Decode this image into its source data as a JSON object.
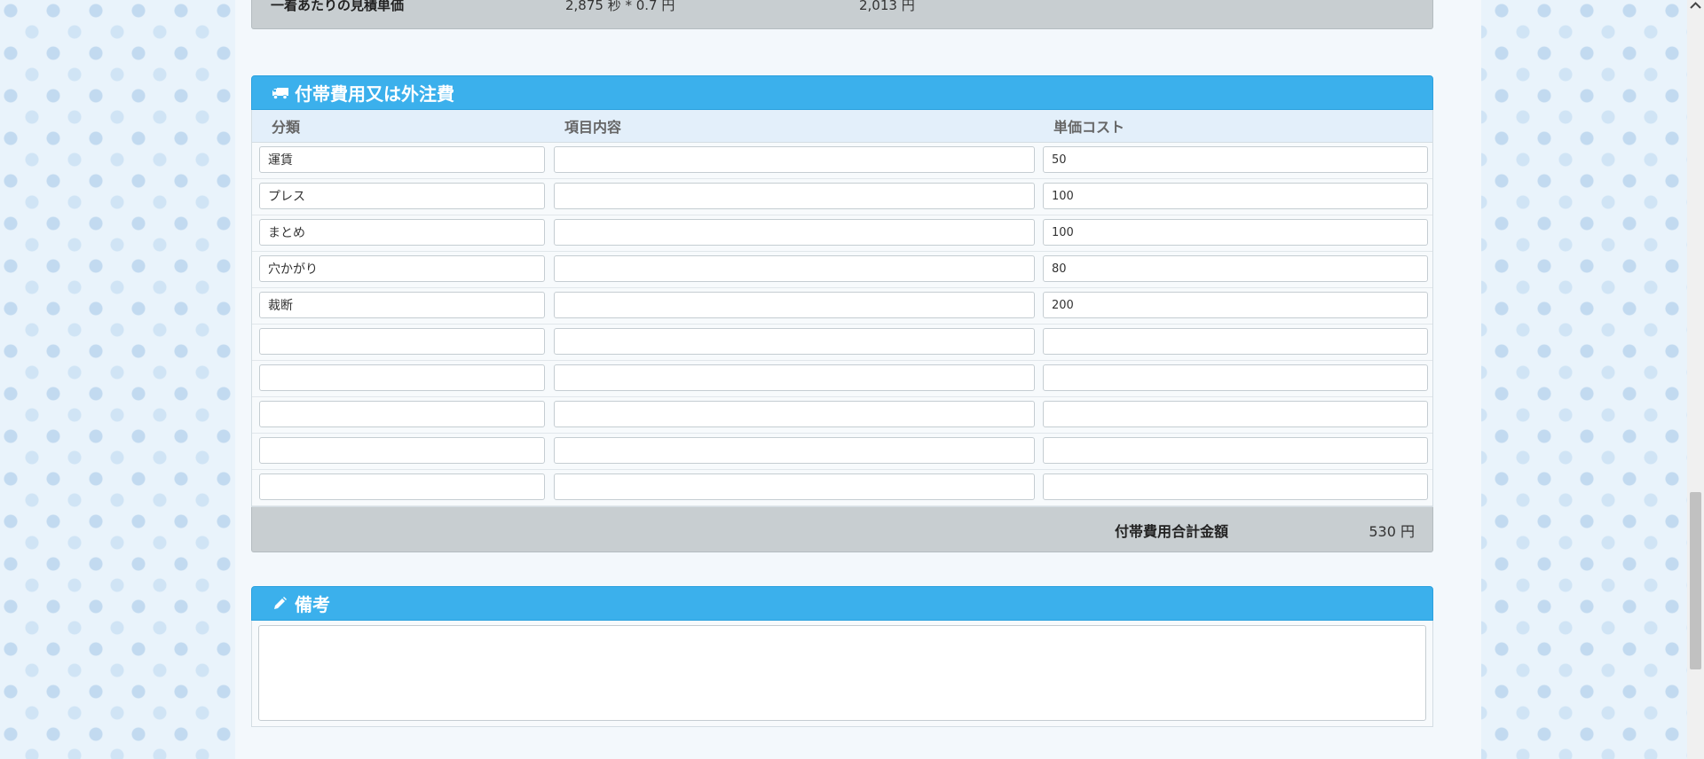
{
  "summary": {
    "label": "一着あたりの見積単価",
    "formula": "2,875 秒 * 0.7 円",
    "result": "2,013 円"
  },
  "incidental_panel": {
    "title": "付帯費用又は外注費",
    "icon": "truck-icon",
    "headers": {
      "category": "分類",
      "content": "項目内容",
      "unit_cost": "単価コスト"
    },
    "rows": [
      {
        "category": "運賃",
        "content": "",
        "unit_cost": "50"
      },
      {
        "category": "プレス",
        "content": "",
        "unit_cost": "100"
      },
      {
        "category": "まとめ",
        "content": "",
        "unit_cost": "100"
      },
      {
        "category": "穴かがり",
        "content": "",
        "unit_cost": "80"
      },
      {
        "category": "裁断",
        "content": "",
        "unit_cost": "200"
      },
      {
        "category": "",
        "content": "",
        "unit_cost": ""
      },
      {
        "category": "",
        "content": "",
        "unit_cost": ""
      },
      {
        "category": "",
        "content": "",
        "unit_cost": ""
      },
      {
        "category": "",
        "content": "",
        "unit_cost": ""
      },
      {
        "category": "",
        "content": "",
        "unit_cost": ""
      }
    ],
    "total_label": "付帯費用合計金額",
    "total_value": "530 円"
  },
  "notes_panel": {
    "title": "備考",
    "icon": "pencil-icon",
    "value": ""
  },
  "colors": {
    "header_blue": "#3bb0ec",
    "total_bar_gray": "#c8ced1",
    "column_header_bg": "#e3effa"
  }
}
